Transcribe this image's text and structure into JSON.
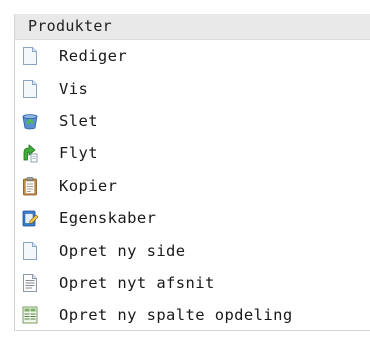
{
  "menu": {
    "title": "Produkter",
    "items": [
      {
        "label": "Rediger",
        "icon": "page-icon"
      },
      {
        "label": "Vis",
        "icon": "page-icon"
      },
      {
        "label": "Slet",
        "icon": "recycle-bin-icon"
      },
      {
        "label": "Flyt",
        "icon": "move-arrow-icon"
      },
      {
        "label": "Kopier",
        "icon": "clipboard-icon"
      },
      {
        "label": "Egenskaber",
        "icon": "properties-icon"
      },
      {
        "label": "Opret ny side",
        "icon": "new-page-icon"
      },
      {
        "label": "Opret nyt afsnit",
        "icon": "text-section-icon"
      },
      {
        "label": "Opret ny spalte opdeling",
        "icon": "column-layout-icon"
      }
    ]
  }
}
